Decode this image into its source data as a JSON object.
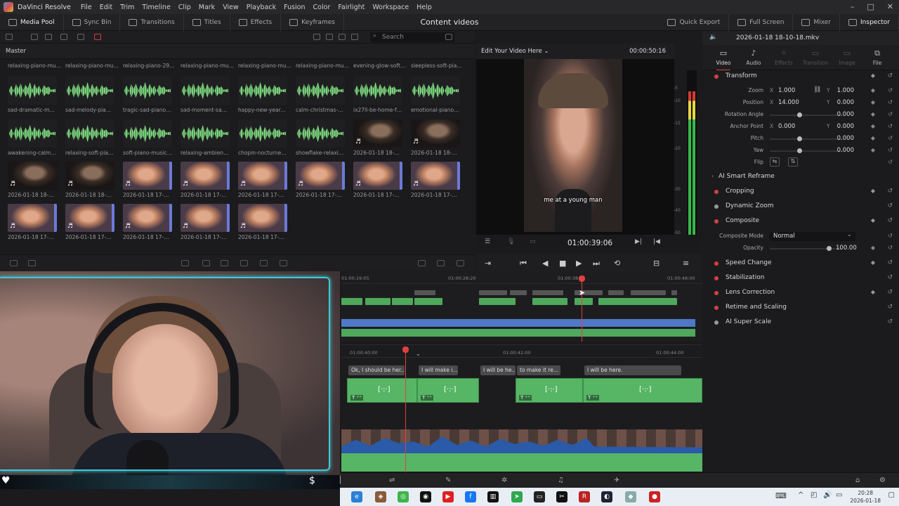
{
  "app": {
    "title": "DaVinci Resolve",
    "menu": [
      "File",
      "Edit",
      "Trim",
      "Timeline",
      "Clip",
      "Mark",
      "View",
      "Playback",
      "Fusion",
      "Color",
      "Fairlight",
      "Workspace",
      "Help"
    ]
  },
  "toolbar": {
    "media_pool": "Media Pool",
    "sync_bin": "Sync Bin",
    "transitions": "Transitions",
    "titles": "Titles",
    "effects": "Effects",
    "keyframes": "Keyframes",
    "project_title": "Content videos",
    "quick_export": "Quick Export",
    "full_screen": "Full Screen",
    "mixer": "Mixer",
    "inspector": "Inspector"
  },
  "media_pool": {
    "search_placeholder": "Search",
    "bin": "Master",
    "top_labels": [
      "relaxing-piano-mu...",
      "relaxing-piano-mu...",
      "relaxing-piano-29...",
      "relaxing-piano-mu...",
      "relaxing-piano-mu...",
      "relaxing-piano-mu...",
      "evening-glow-soft-...",
      "sleepless-soft-pia..."
    ],
    "clips": [
      {
        "label": "sad-dramatic-mus...",
        "kind": "audio"
      },
      {
        "label": "sad-melody-piano...",
        "kind": "audio"
      },
      {
        "label": "tragic-sad-piano-...",
        "kind": "audio"
      },
      {
        "label": "sad-moment-sad-...",
        "kind": "audio"
      },
      {
        "label": "happy-new-year-p...",
        "kind": "audio"
      },
      {
        "label": "calm-christmas-pi...",
        "kind": "audio"
      },
      {
        "label": "ix27ll-be-home-fo...",
        "kind": "audio"
      },
      {
        "label": "emotional-piano-...",
        "kind": "audio"
      },
      {
        "label": "awakening-calm-p...",
        "kind": "audio"
      },
      {
        "label": "relaxing-soft-pian...",
        "kind": "audio"
      },
      {
        "label": "soft-piano-music-...",
        "kind": "audio"
      },
      {
        "label": "relaxing-ambient-...",
        "kind": "audio"
      },
      {
        "label": "chopin-nocturne-...",
        "kind": "audio"
      },
      {
        "label": "showflake-relaxin...",
        "kind": "audio"
      },
      {
        "label": "2026-01-18 18-05...",
        "kind": "dark"
      },
      {
        "label": "2026-01-18 18-08-...",
        "kind": "dark"
      },
      {
        "label": "2026-01-18 18-10...",
        "kind": "dark"
      },
      {
        "label": "2026-01-18 18-12...",
        "kind": "dark"
      },
      {
        "label": "2026-01-18 17-38-...",
        "kind": "bright"
      },
      {
        "label": "2026-01-18 17-06-...",
        "kind": "bright"
      },
      {
        "label": "2026-01-18 17-06-...",
        "kind": "bright"
      },
      {
        "label": "2026-01-18 17-00-...",
        "kind": "bright"
      },
      {
        "label": "2026-01-18 17-12-...",
        "kind": "bright"
      },
      {
        "label": "2026-01-18 17-28-...",
        "kind": "bright"
      },
      {
        "label": "2026-01-18 17-09-...",
        "kind": "bright"
      },
      {
        "label": "2026-01-18 17-14-...",
        "kind": "bright"
      },
      {
        "label": "2026-01-18 17-33-...",
        "kind": "bright"
      },
      {
        "label": "2026-01-18 17-32-...",
        "kind": "bright"
      },
      {
        "label": "2026-01-18 17-34-...",
        "kind": "bright"
      }
    ]
  },
  "viewer": {
    "title": "Edit Your Video Here",
    "duration": "00:00:50:16",
    "caption": "me at a young man",
    "timecode": "01:00:39:06",
    "meter_ticks": [
      "-5",
      "-10",
      "-15",
      "-20",
      "-30",
      "-40",
      "-50"
    ],
    "audio_level": 0.88
  },
  "inspector": {
    "filename": "2026-01-18 18-10-18.mkv",
    "tabs": [
      "Video",
      "Audio",
      "Effects",
      "Transition",
      "Image",
      "File"
    ],
    "transform": {
      "title": "Transform",
      "zoom_label": "Zoom",
      "zoom_x": "1.000",
      "zoom_y": "1.000",
      "position_label": "Position",
      "position_x": "14.000",
      "position_y": "0.000",
      "rotation_label": "Rotation Angle",
      "rotation": "0.000",
      "anchor_label": "Anchor Point",
      "anchor_x": "0.000",
      "anchor_y": "0.000",
      "pitch_label": "Pitch",
      "pitch": "0.000",
      "yaw_label": "Yaw",
      "yaw": "0.000",
      "flip_label": "Flip"
    },
    "smart_reframe": "AI Smart Reframe",
    "cropping": "Cropping",
    "dynamic_zoom": "Dynamic Zoom",
    "composite": {
      "title": "Composite",
      "mode_label": "Composite Mode",
      "mode": "Normal",
      "opacity_label": "Opacity",
      "opacity": "100.00"
    },
    "speed_change": "Speed Change",
    "stabilization": "Stabilization",
    "lens_correction": "Lens Correction",
    "retime": "Retime and Scaling",
    "super_scale": "AI Super Scale",
    "axis_x": "X",
    "axis_y": "Y"
  },
  "timeline": {
    "overview_ticks": [
      "01:00:19:05",
      "01:00:28:20",
      "01:00:38:",
      "01:00:48:00"
    ],
    "main_ticks": [
      "01:00:40:00",
      "01:00:42:00",
      "01:00:44:00"
    ],
    "subtitles": [
      "Ok, I should be her...",
      "I will make i...",
      "I will be he...",
      "to make it re...",
      "I will be here."
    ],
    "clip_icon": "[·:·]",
    "clip_badge": "T ⁺⁺"
  },
  "taskbar": {
    "time": "20:28",
    "date": "2026-01-18"
  }
}
